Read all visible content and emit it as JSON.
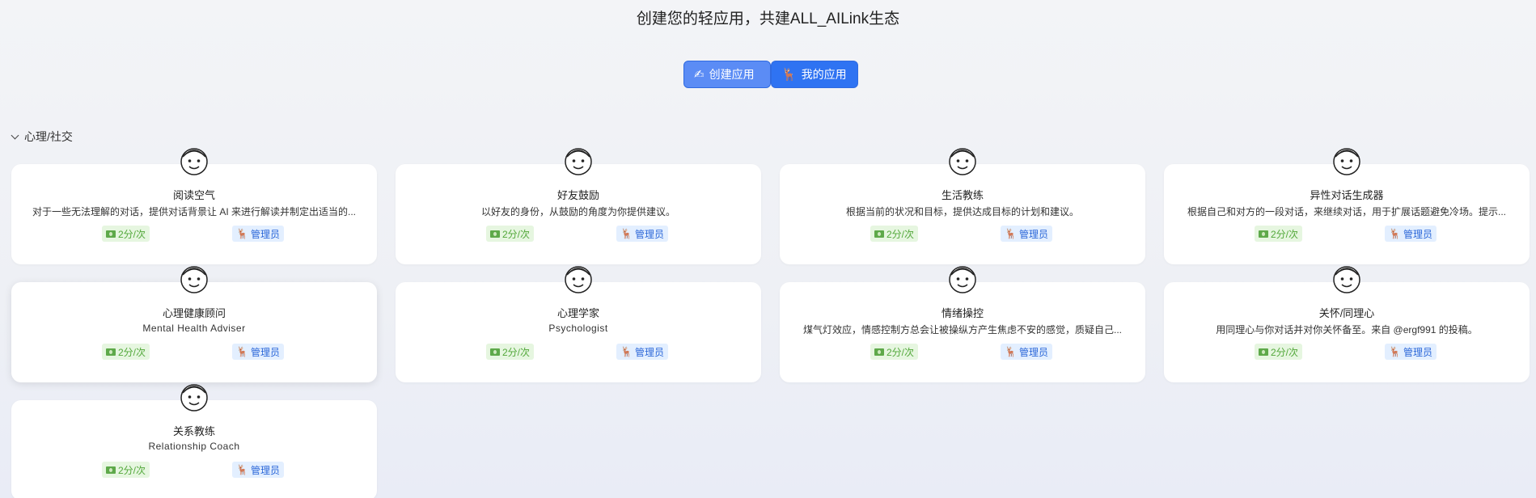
{
  "header": {
    "title": "创建您的轻应用，共建ALL_AILink生态"
  },
  "buttons": {
    "create_label": "创建应用",
    "create_icon": "writing-hand-icon",
    "mine_label": "我的应用",
    "mine_icon": "deer-icon"
  },
  "section": {
    "title": "心理/社交"
  },
  "cards": [
    {
      "name": "阅读空气",
      "desc": "对于一些无法理解的对话，提供对话背景让 AI 来进行解读并制定出适当的...",
      "price": "2分/次",
      "owner": "管理员"
    },
    {
      "name": "好友鼓励",
      "desc": "以好友的身份，从鼓励的角度为你提供建议。",
      "price": "2分/次",
      "owner": "管理员"
    },
    {
      "name": "生活教练",
      "desc": "根据当前的状况和目标，提供达成目标的计划和建议。",
      "price": "2分/次",
      "owner": "管理员"
    },
    {
      "name": "异性对话生成器",
      "desc": "根据自己和对方的一段对话，来继续对话，用于扩展话题避免冷场。提示...",
      "price": "2分/次",
      "owner": "管理员"
    },
    {
      "name": "心理健康顾问",
      "desc": "Mental Health Adviser",
      "price": "2分/次",
      "owner": "管理员"
    },
    {
      "name": "心理学家",
      "desc": "Psychologist",
      "price": "2分/次",
      "owner": "管理员"
    },
    {
      "name": "情绪操控",
      "desc": "煤气灯效应，情感控制方总会让被操纵方产生焦虑不安的感觉，质疑自己...",
      "price": "2分/次",
      "owner": "管理员"
    },
    {
      "name": "关怀/同理心",
      "desc": "用同理心与你对话并对你关怀备至。来自 @ergf991 的投稿。",
      "price": "2分/次",
      "owner": "管理员"
    },
    {
      "name": "关系教练",
      "desc": "Relationship Coach",
      "price": "2分/次",
      "owner": "管理员"
    }
  ],
  "colors": {
    "primary_button": "#2f73f2",
    "price_badge_bg": "#e6f6e0",
    "price_badge_text": "#52a83a",
    "admin_badge_bg": "#e3efff",
    "admin_badge_text": "#2b67d8"
  }
}
